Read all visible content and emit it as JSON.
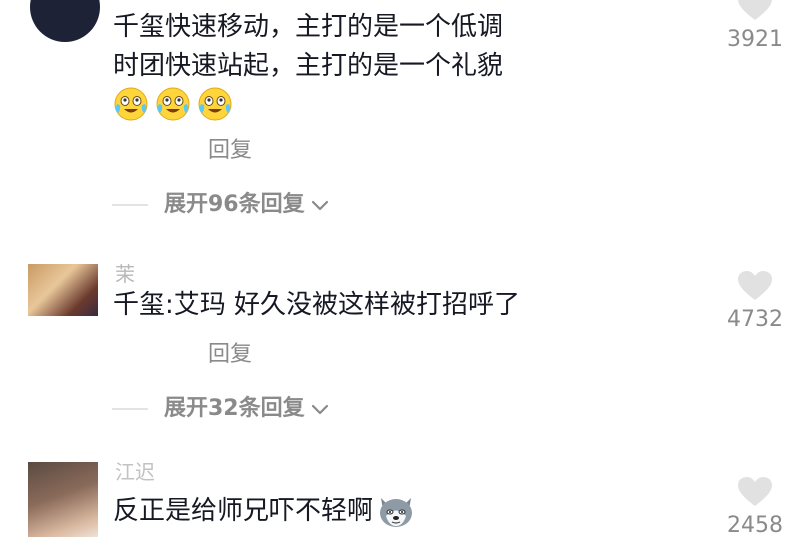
{
  "comments": [
    {
      "text_lines": [
        "千玺快速移动，主打的是一个低调",
        "时团快速站起，主打的是一个礼貌"
      ],
      "emojis": [
        "crying-laughing-emoji",
        "crying-laughing-emoji",
        "crying-laughing-emoji"
      ],
      "reply_label": "回复",
      "expand_label": "展开96条回复",
      "like_count": "3921"
    },
    {
      "username": "茉",
      "text": "千玺:艾玛 好久没被这样被打招呼了",
      "reply_label": "回复",
      "expand_label": "展开32条回复",
      "like_count": "4732"
    },
    {
      "username": "江迟",
      "text": "反正是给师兄吓不轻啊",
      "emoji": "husky-dog-emoji",
      "like_count": "2458"
    }
  ],
  "icons": {
    "like": "heart-icon",
    "expand": "chevron-down-icon"
  },
  "colors": {
    "text": "#161823",
    "secondary": "#8a8a8a",
    "heart": "#e1e1e1"
  }
}
